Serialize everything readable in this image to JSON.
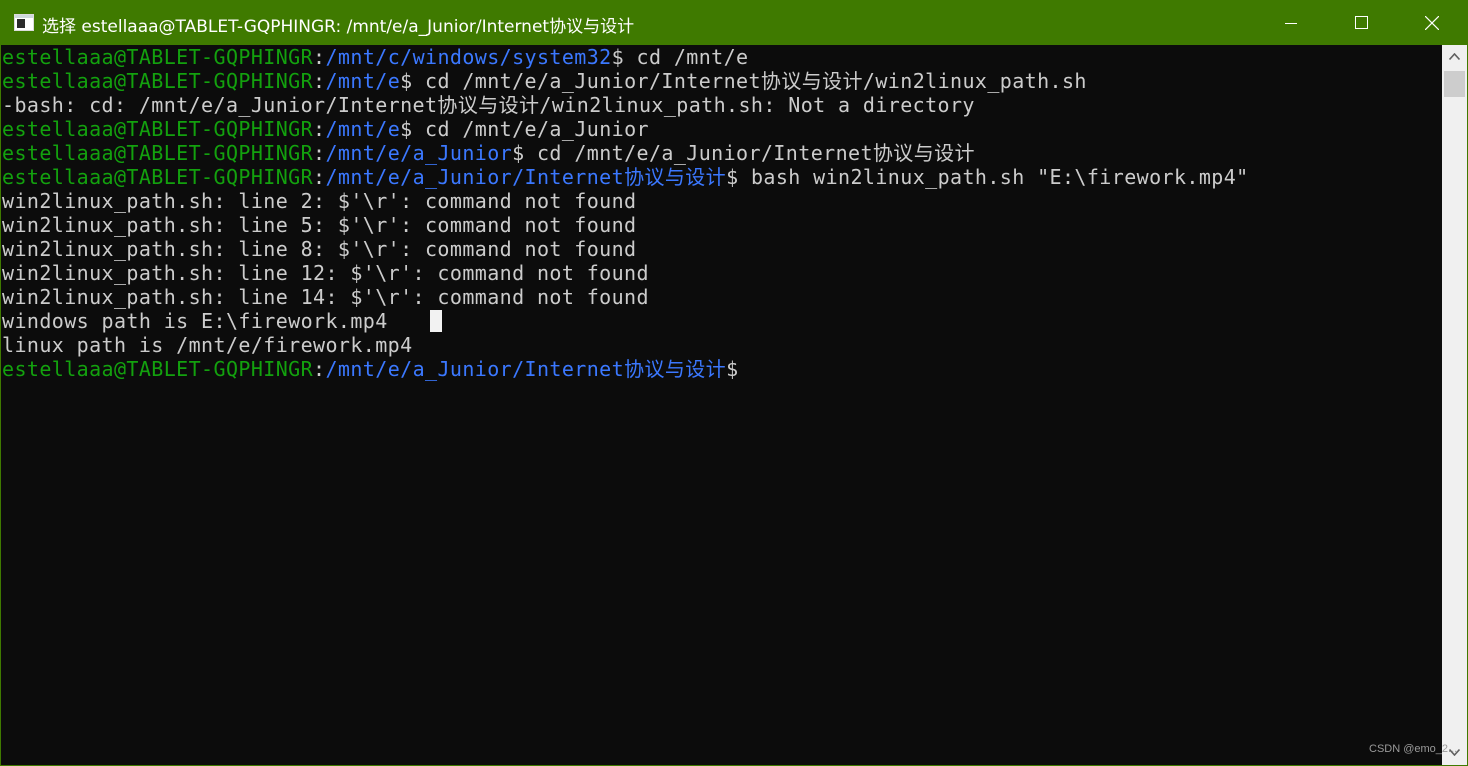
{
  "window": {
    "title": "选择 estellaaa@TABLET-GQPHINGR: /mnt/e/a_Junior/Internet协议与设计",
    "title_bar_color": "#3f7a00",
    "minimize_icon": "minimize-icon",
    "maximize_icon": "maximize-icon",
    "close_icon": "close-icon"
  },
  "colors": {
    "background": "#0c0c0c",
    "user_host": "#13a10e",
    "path": "#3b78ff",
    "text": "#cccccc"
  },
  "terminal": {
    "lines": [
      {
        "user": "estellaaa@TABLET-GQPHINGR",
        "sep": ":",
        "path": "/mnt/c/windows/system32",
        "cmd": "$ cd /mnt/e"
      },
      {
        "user": "estellaaa@TABLET-GQPHINGR",
        "sep": ":",
        "path": "/mnt/e",
        "cmd": "$ cd /mnt/e/a_Junior/Internet协议与设计/win2linux_path.sh"
      },
      {
        "text": "-bash: cd: /mnt/e/a_Junior/Internet协议与设计/win2linux_path.sh: Not a directory"
      },
      {
        "user": "estellaaa@TABLET-GQPHINGR",
        "sep": ":",
        "path": "/mnt/e",
        "cmd": "$ cd /mnt/e/a_Junior"
      },
      {
        "user": "estellaaa@TABLET-GQPHINGR",
        "sep": ":",
        "path": "/mnt/e/a_Junior",
        "cmd": "$ cd /mnt/e/a_Junior/Internet协议与设计"
      },
      {
        "user": "estellaaa@TABLET-GQPHINGR",
        "sep": ":",
        "path": "/mnt/e/a_Junior/Internet协议与设计",
        "cmd": "$ bash win2linux_path.sh \"E:\\firework.mp4\""
      },
      {
        "text": "win2linux_path.sh: line 2: $'\\r': command not found"
      },
      {
        "text": "win2linux_path.sh: line 5: $'\\r': command not found"
      },
      {
        "text": "win2linux_path.sh: line 8: $'\\r': command not found"
      },
      {
        "text": "win2linux_path.sh: line 12: $'\\r': command not found"
      },
      {
        "text": "win2linux_path.sh: line 14: $'\\r': command not found"
      },
      {
        "text": "windows path is E:\\firework.mp4"
      },
      {
        "text": "linux path is /mnt/e/firework.mp4"
      },
      {
        "user": "estellaaa@TABLET-GQPHINGR",
        "sep": ":",
        "path": "/mnt/e/a_Junior/Internet协议与设计",
        "cmd": "$"
      }
    ]
  },
  "watermark": "CSDN @emo_2..."
}
